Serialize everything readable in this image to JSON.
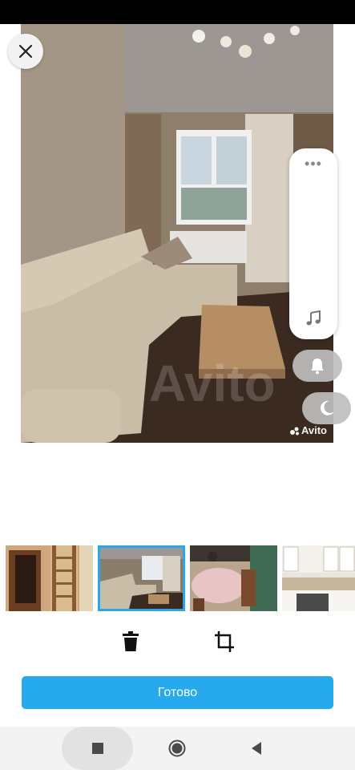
{
  "viewer": {
    "watermark_text": "Avito",
    "background_watermark": "Avito"
  },
  "float_panel": {
    "more_label": "•••"
  },
  "icons": {
    "close": "close-icon",
    "more": "more-dots-icon",
    "music": "music-note-icon",
    "bell": "bell-icon",
    "moon": "moon-icon",
    "trash": "trash-icon",
    "crop": "crop-icon",
    "recent": "recent-apps-icon",
    "home": "home-icon",
    "back": "back-icon"
  },
  "thumbnails": [
    {
      "name": "thumb-hallway",
      "selected": false
    },
    {
      "name": "thumb-living-room",
      "selected": true
    },
    {
      "name": "thumb-dining",
      "selected": false
    },
    {
      "name": "thumb-kitchen",
      "selected": false
    }
  ],
  "footer": {
    "done_label": "Готово"
  },
  "colors": {
    "accent": "#27a9ee",
    "selected_border": "#29a8e8"
  }
}
